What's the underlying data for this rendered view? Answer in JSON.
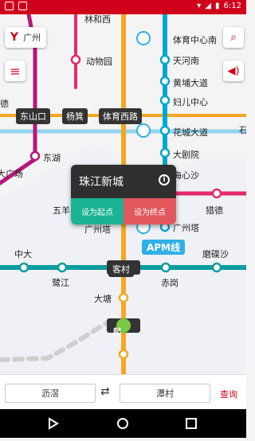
{
  "status_bar": {
    "time": "6:12"
  },
  "city": "广州",
  "stations": [
    "林和西",
    "体育中心南",
    "天河南",
    "黄埔大道",
    "妇儿中心",
    "花城大道",
    "大剧院",
    "海心沙",
    "广州塔",
    "猎德",
    "动物园",
    "东湖",
    "五羊",
    "中大",
    "鹭江",
    "客村",
    "赤岗",
    "磨碟沙",
    "大塘",
    "珠江新城",
    "石"
  ],
  "partial_labels": [
    "德",
    "大广场"
  ],
  "roads": [
    "东山口",
    "杨箕",
    "体育西路"
  ],
  "line_label": "APM线",
  "bottom_marker": "起",
  "popup": {
    "station": "珠江新城",
    "set_start": "设为起点",
    "set_end": "设为终点"
  },
  "bottom_bar": {
    "from": "沥滘",
    "to": "潭村",
    "query": "查询"
  },
  "colors": {
    "accent": "#d0021b",
    "line_orange": "#f5a623",
    "line_cyan": "#00a8cc",
    "line_teal": "#0a9e9e",
    "line_magenta": "#b5167a",
    "line_pink": "#e6296a"
  }
}
